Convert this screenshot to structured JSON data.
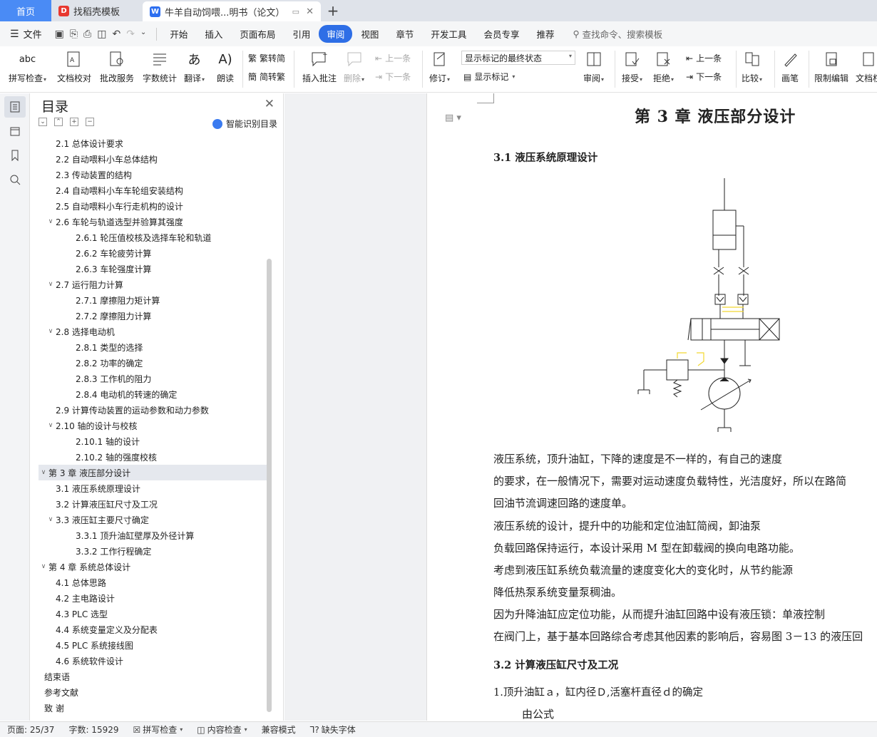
{
  "tabs": {
    "home": "首页",
    "tab1": "找稻壳模板",
    "tab2": "牛羊自动饲喂...明书（论文）"
  },
  "menubar": {
    "file": "文件",
    "items": [
      "开始",
      "插入",
      "页面布局",
      "引用",
      "审阅",
      "视图",
      "章节",
      "开发工具",
      "会员专享",
      "推荐"
    ],
    "active": "审阅",
    "search": "查找命令、搜索模板"
  },
  "ribbon": {
    "spell": "拼写检查",
    "doc_check": "文档校对",
    "annot_service": "批改服务",
    "word_count": "字数统计",
    "translate": "翻译",
    "read_aloud": "朗读",
    "trad": "繁转简",
    "simp": "简转繁",
    "insert_comment": "插入批注",
    "delete": "删除",
    "prev_comment": "上一条",
    "next_comment": "下一条",
    "revise": "修订",
    "show_state": "显示标记的最终状态",
    "show_marks": "显示标记",
    "review": "审阅",
    "accept": "接受",
    "reject": "拒绝",
    "prev": "上一条",
    "next": "下一条",
    "compare": "比较",
    "pen": "画笔",
    "restrict": "限制编辑",
    "doc_right": "文档权"
  },
  "outline": {
    "title": "目录",
    "smart": "智能识别目录",
    "items": [
      {
        "text": "2.1  总体设计要求",
        "level": 2,
        "chev": ""
      },
      {
        "text": "2.2  自动喂料小车总体结构",
        "level": 2,
        "chev": ""
      },
      {
        "text": "2.3  传动装置的结构",
        "level": 2,
        "chev": ""
      },
      {
        "text": "2.4  自动喂料小车车轮组安装结构",
        "level": 2,
        "chev": ""
      },
      {
        "text": "2.5 自动喂料小车行走机构的设计",
        "level": 2,
        "chev": ""
      },
      {
        "text": "2.6 车轮与轨道选型并验算其强度",
        "level": 2,
        "chev": "v"
      },
      {
        "text": "2.6.1 轮压值校核及选择车轮和轨道",
        "level": 3,
        "chev": ""
      },
      {
        "text": "2.6.2 车轮疲劳计算",
        "level": 3,
        "chev": ""
      },
      {
        "text": "2.6.3 车轮强度计算",
        "level": 3,
        "chev": ""
      },
      {
        "text": "2.7    运行阻力计算",
        "level": 2,
        "chev": "v"
      },
      {
        "text": "2.7.1 摩擦阻力矩计算",
        "level": 3,
        "chev": ""
      },
      {
        "text": "2.7.2 摩擦阻力计算",
        "level": 3,
        "chev": ""
      },
      {
        "text": "2.8  选择电动机",
        "level": 2,
        "chev": "v"
      },
      {
        "text": "2.8.1 类型的选择",
        "level": 3,
        "chev": ""
      },
      {
        "text": "2.8.2 功率的确定",
        "level": 3,
        "chev": ""
      },
      {
        "text": "2.8.3 工作机的阻力",
        "level": 3,
        "chev": ""
      },
      {
        "text": "2.8.4 电动机的转速的确定",
        "level": 3,
        "chev": ""
      },
      {
        "text": "2.9 计算传动装置的运动参数和动力参数",
        "level": 2,
        "chev": ""
      },
      {
        "text": "2.10 轴的设计与校核",
        "level": 2,
        "chev": "v"
      },
      {
        "text": "2.10.1 轴的设计",
        "level": 3,
        "chev": ""
      },
      {
        "text": "2.10.2  轴的强度校核",
        "level": 3,
        "chev": ""
      },
      {
        "text": "第 3 章  液压部分设计",
        "level": 1,
        "chev": "v",
        "sel": true
      },
      {
        "text": "3.1  液压系统原理设计",
        "level": 2,
        "chev": ""
      },
      {
        "text": "3.2 计算液压缸尺寸及工况",
        "level": 2,
        "chev": ""
      },
      {
        "text": "3.3 液压缸主要尺寸确定",
        "level": 2,
        "chev": "v"
      },
      {
        "text": "3.3.1 顶升油缸壁厚及外径计算",
        "level": 3,
        "chev": ""
      },
      {
        "text": "3.3.2 工作行程确定",
        "level": 3,
        "chev": ""
      },
      {
        "text": "第 4 章  系统总体设计",
        "level": 1,
        "chev": "v"
      },
      {
        "text": "4.1  总体思路",
        "level": 2,
        "chev": ""
      },
      {
        "text": "4.2  主电路设计",
        "level": 2,
        "chev": ""
      },
      {
        "text": "4.3 PLC 选型",
        "level": 2,
        "chev": ""
      },
      {
        "text": "4.4  系统变量定义及分配表",
        "level": 2,
        "chev": ""
      },
      {
        "text": "4.5 PLC  系统接线图",
        "level": 2,
        "chev": ""
      },
      {
        "text": "4.6 系统软件设计",
        "level": 2,
        "chev": ""
      },
      {
        "text": "结束语",
        "level": 1,
        "chev": ""
      },
      {
        "text": "参考文献",
        "level": 1,
        "chev": ""
      },
      {
        "text": "致     谢",
        "level": 1,
        "chev": ""
      }
    ]
  },
  "doc": {
    "chapter": "第 3 章  液压部分设计",
    "sec31": "3.1  液压系统原理设计",
    "paras": [
      "液压系统，顶升油缸，下降的速度是不一样的，有自己的速度",
      "的要求，在一般情况下，需要对运动速度负载特性，光洁度好，所以在路简",
      "回油节流调速回路的速度单。",
      "液压系统的设计，提升中的功能和定位油缸简阀，卸油泵",
      "负载回路保持运行，本设计采用 M 型在卸载阀的换向电路功能。",
      "考虑到液压缸系统负载流量的速度变化大的变化时，从节约能源",
      "降低热泵系统变量泵稠油。",
      "因为升降油缸应定位功能，从而提升油缸回路中设有液压锁：单液控制",
      "在阀门上，基于基本回路综合考虑其他因素的影响后，容易图 3－13 的液压回"
    ],
    "sec32": "3.2 计算液压缸尺寸及工况",
    "item1": "1.顶升油缸ａ，缸内径Ｄ,活塞杆直径ｄ的确定",
    "formula": "由公式"
  },
  "status": {
    "page": "页面: 25/37",
    "words": "字数: 15929",
    "spell": "拼写检查",
    "content_check": "内容检查",
    "compat": "兼容模式",
    "missing_font": "缺失字体"
  },
  "colors": {
    "accent": "#2e6ee6",
    "home_tab": "#4a8bf5",
    "diagram_highlight": "#f2d830"
  }
}
